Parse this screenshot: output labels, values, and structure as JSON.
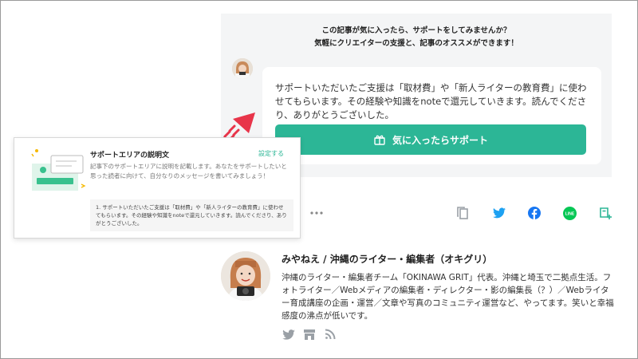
{
  "support": {
    "heading_line1": "この記事が気に入ったら、サポートをしてみませんか？",
    "heading_line2": "気軽にクリエイターの支援と、記事のオススメができます！",
    "message": "サポートいただいたご支援は「取材費」や「新人ライターの教育費」に使わせてもらいます。その経験や知識をnoteで還元していきます。読んでくださり、ありがとうございした。",
    "button_label": "気に入ったらサポート",
    "button_icon": "gift-icon"
  },
  "description_card": {
    "title": "サポートエリアの説明文",
    "setting_link": "設定する",
    "body": "記事下のサポートエリアに説明を記載します。あなたをサポートしたいと思った読者に向けて、自分なりのメッセージを書いてみましょう！",
    "example": "1. サポートいただいたご支援は「取材費」や「新人ライターの教育費」に使わせてもらいます。その経験や知識をnoteで還元していきます。読んでくださり、ありがとうございした。"
  },
  "share_icons": [
    "more-icon",
    "copy-link-icon",
    "twitter-icon",
    "facebook-icon",
    "line-icon",
    "add-magazine-icon"
  ],
  "share_labels": {
    "line": "LINE"
  },
  "author": {
    "name": "みやねえ / 沖縄のライター・編集者（オキグリ）",
    "bio": "沖縄のライター・編集者チーム「OKINAWA GRIT」代表。沖縄と埼玉で二拠点生活。フォトライター／Webメディアの編集者・ディレクター・影の編集長（？）／Webライター育成講座の企画・運営／文章や写真のコミュニティ運営など、やってます。笑いと幸福感度の沸点が低いです。",
    "links": [
      "twitter-icon",
      "store-icon",
      "rss-icon"
    ]
  },
  "colors": {
    "accent": "#2cb696",
    "arrow": "#e8354a",
    "twitter": "#1da1f2",
    "facebook": "#1877f2",
    "line": "#06c755",
    "icon_gray": "#9aa0a6"
  }
}
